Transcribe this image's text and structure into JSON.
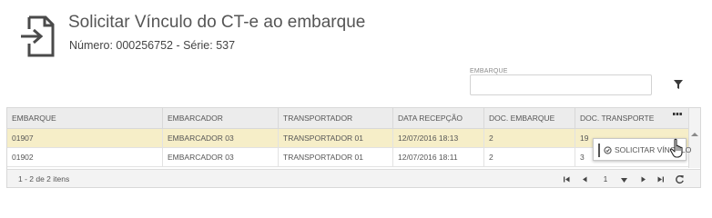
{
  "header": {
    "icon": "document-arrow-in-icon",
    "title": "Solicitar Vínculo do CT-e ao embarque",
    "subtitle": "Número: 000256752 - Série: 537"
  },
  "filter": {
    "label": "EMBARQUE",
    "value": "",
    "icon": "filter-icon"
  },
  "grid": {
    "columns": [
      "EMBARQUE",
      "EMBARCADOR",
      "TRANSPORTADOR",
      "DATA RECEPÇÃO",
      "DOC. EMBARQUE",
      "DOC. TRANSPORTE"
    ],
    "rows": [
      [
        "01907",
        "EMBARCADOR 03",
        "TRANSPORTADOR 01",
        "12/07/2016 18:13",
        "2",
        "19"
      ],
      [
        "01902",
        "EMBARCADOR 03",
        "TRANSPORTADOR 01",
        "12/07/2016 18:11",
        "2",
        "3"
      ]
    ],
    "selected_row": 0,
    "footer": {
      "info": "1 - 2 de 2 itens",
      "page": "1"
    }
  },
  "context_menu": {
    "item": "SOLICITAR VÍNCULO",
    "icon": "check-circle-icon"
  },
  "colors": {
    "selected_row": "#f6eec8",
    "header_bg": "#ececec"
  }
}
